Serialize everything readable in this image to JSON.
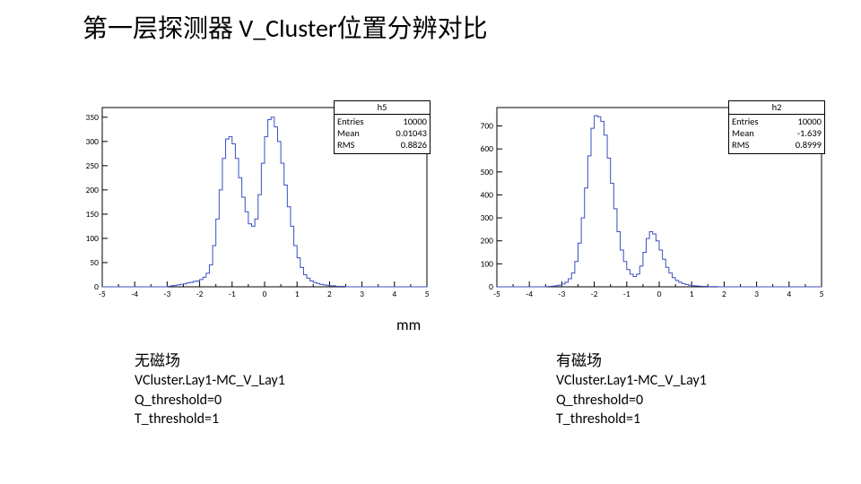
{
  "title": "第一层探测器 V_Cluster位置分辨对比",
  "unit": "mm",
  "left": {
    "caption": {
      "head": "无磁场",
      "l1": "VCluster.Lay1-MC_V_Lay1",
      "l2": "Q_threshold=0",
      "l3": "T_threshold=1"
    },
    "stats": {
      "title": "h5",
      "entries_label": "Entries",
      "entries": "10000",
      "mean_label": "Mean",
      "mean": "0.01043",
      "rms_label": "RMS",
      "rms": "0.8826"
    }
  },
  "right": {
    "caption": {
      "head": "有磁场",
      "l1": "VCluster.Lay1-MC_V_Lay1",
      "l2": "Q_threshold=0",
      "l3": "T_threshold=1"
    },
    "stats": {
      "title": "h2",
      "entries_label": "Entries",
      "entries": "10000",
      "mean_label": "Mean",
      "mean": "-1.639",
      "rms_label": "RMS",
      "rms": "0.8999"
    }
  },
  "chart_data": [
    {
      "type": "histogram-step",
      "title": "h5",
      "xlabel": "",
      "ylabel": "",
      "xlim": [
        -5,
        5
      ],
      "ylim": [
        0,
        370
      ],
      "xticks": [
        -5,
        -4,
        -3,
        -2,
        -1,
        0,
        1,
        2,
        3,
        4,
        5
      ],
      "yticks": [
        0,
        50,
        100,
        150,
        200,
        250,
        300,
        350
      ],
      "bin_width": 0.1,
      "bins_x_start": -5.0,
      "counts": [
        0,
        0,
        0,
        0,
        0,
        0,
        0,
        0,
        0,
        0,
        0,
        0,
        0,
        0,
        0,
        0,
        0,
        0,
        0,
        0,
        1,
        2,
        3,
        4,
        5,
        6,
        8,
        9,
        11,
        12,
        15,
        20,
        28,
        45,
        85,
        140,
        200,
        265,
        305,
        310,
        295,
        265,
        225,
        185,
        155,
        130,
        125,
        140,
        190,
        255,
        310,
        345,
        350,
        330,
        300,
        255,
        210,
        165,
        125,
        85,
        60,
        40,
        25,
        18,
        12,
        9,
        7,
        5,
        4,
        3,
        2,
        2,
        1,
        1,
        1,
        0,
        0,
        0,
        0,
        0,
        0,
        0,
        0,
        0,
        0,
        0,
        0,
        0,
        0,
        0,
        0,
        0,
        0,
        0,
        0,
        0,
        0,
        0,
        0,
        0
      ]
    },
    {
      "type": "histogram-step",
      "title": "h2",
      "xlabel": "",
      "ylabel": "",
      "xlim": [
        -5,
        5
      ],
      "ylim": [
        0,
        780
      ],
      "xticks": [
        -5,
        -4,
        -3,
        -2,
        -1,
        0,
        1,
        2,
        3,
        4,
        5
      ],
      "yticks": [
        0,
        100,
        200,
        300,
        400,
        500,
        600,
        700
      ],
      "bin_width": 0.1,
      "bins_x_start": -5.0,
      "counts": [
        0,
        0,
        0,
        0,
        0,
        0,
        0,
        0,
        0,
        0,
        0,
        0,
        0,
        0,
        0,
        1,
        2,
        3,
        5,
        8,
        12,
        20,
        35,
        60,
        110,
        190,
        300,
        430,
        570,
        690,
        745,
        740,
        720,
        660,
        560,
        450,
        340,
        240,
        160,
        110,
        75,
        55,
        45,
        55,
        90,
        150,
        210,
        240,
        230,
        200,
        160,
        120,
        85,
        60,
        40,
        28,
        20,
        14,
        10,
        7,
        5,
        4,
        3,
        2,
        2,
        1,
        1,
        1,
        0,
        0,
        0,
        0,
        0,
        0,
        0,
        0,
        0,
        0,
        0,
        0,
        0,
        0,
        0,
        0,
        0,
        0,
        0,
        0,
        0,
        0,
        0,
        0,
        0,
        0,
        0,
        0,
        0,
        0,
        0,
        0
      ]
    }
  ]
}
